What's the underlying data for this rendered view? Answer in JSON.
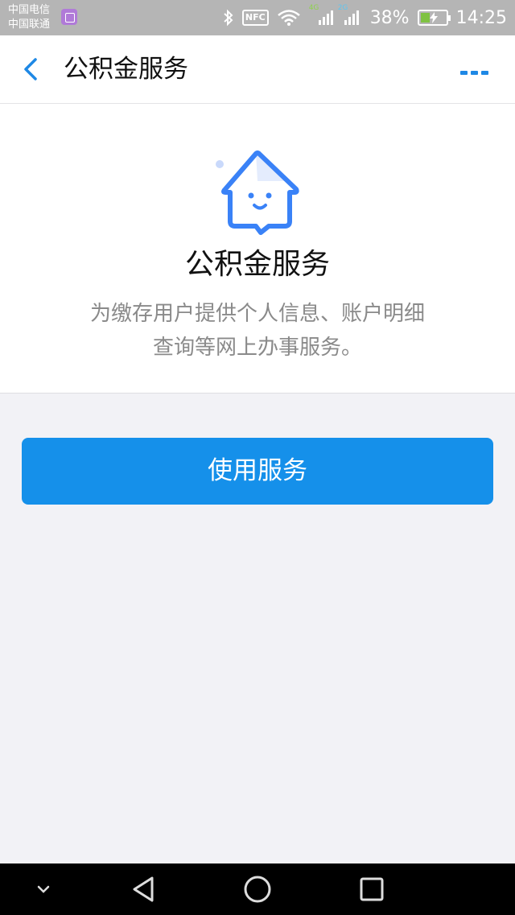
{
  "status_bar": {
    "carrier_1": "中国电信",
    "carrier_2": "中国联通",
    "network_1": "4G",
    "network_2": "2G",
    "battery": "38%",
    "battery_level": 0.38,
    "time": "14:25",
    "nfc_label": "NFC",
    "icons": [
      "gallery-icon",
      "bluetooth-icon",
      "nfc-icon",
      "wifi-icon",
      "signal-icon",
      "battery-icon"
    ]
  },
  "navbar": {
    "title": "公积金服务",
    "back_icon": "chevron-left-icon",
    "more_icon": "more-icon",
    "accent_color": "#1e88e5"
  },
  "intro": {
    "icon": "house-smile-icon",
    "title": "公积金服务",
    "description": "为缴存用户提供个人信息、账户明细查询等网上办事服务。"
  },
  "actions": {
    "use_service": "使用服务",
    "button_color": "#1590ea"
  },
  "system_nav": {
    "icons": [
      "collapse-icon",
      "back-triangle-icon",
      "home-circle-icon",
      "recents-square-icon"
    ]
  }
}
